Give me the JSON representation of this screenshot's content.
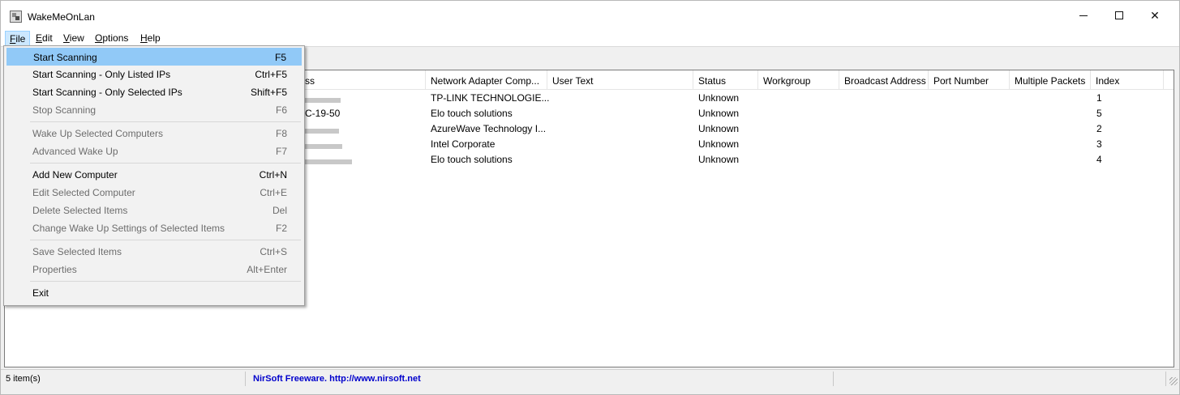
{
  "window": {
    "title": "WakeMeOnLan"
  },
  "menubar": {
    "items": [
      {
        "label": "File",
        "access_key": "F",
        "rest": "ile"
      },
      {
        "label": "Edit",
        "access_key": "E",
        "rest": "dit"
      },
      {
        "label": "View",
        "access_key": "V",
        "rest": "iew"
      },
      {
        "label": "Options",
        "access_key": "O",
        "rest": "ptions"
      },
      {
        "label": "Help",
        "access_key": "H",
        "rest": "elp"
      }
    ]
  },
  "file_menu": {
    "items": [
      {
        "label": "Start Scanning",
        "shortcut": "F5",
        "enabled": true,
        "highlighted": true
      },
      {
        "label": "Start Scanning - Only Listed IPs",
        "shortcut": "Ctrl+F5",
        "enabled": true
      },
      {
        "label": "Start Scanning - Only Selected IPs",
        "shortcut": "Shift+F5",
        "enabled": true
      },
      {
        "label": "Stop Scanning",
        "shortcut": "F6",
        "enabled": false
      },
      {
        "label": "Wake Up Selected Computers",
        "shortcut": "F8",
        "enabled": false
      },
      {
        "label": "Advanced Wake Up",
        "shortcut": "F7",
        "enabled": false
      },
      {
        "label": "Add New Computer",
        "shortcut": "Ctrl+N",
        "enabled": true
      },
      {
        "label": "Edit Selected Computer",
        "shortcut": "Ctrl+E",
        "enabled": false
      },
      {
        "label": "Delete Selected Items",
        "shortcut": "Del",
        "enabled": false
      },
      {
        "label": "Change Wake Up Settings of Selected Items",
        "shortcut": "F2",
        "enabled": false
      },
      {
        "label": "Save Selected Items",
        "shortcut": "Ctrl+S",
        "enabled": false
      },
      {
        "label": "Properties",
        "shortcut": "Alt+Enter",
        "enabled": false
      },
      {
        "label": "Exit",
        "shortcut": "",
        "enabled": true
      }
    ]
  },
  "table": {
    "columns": [
      "ss",
      "Network Adapter Comp...",
      "User Text",
      "Status",
      "Workgroup",
      "Broadcast Address",
      "Port Number",
      "Multiple Packets",
      "Index"
    ],
    "rows": [
      {
        "mac": "",
        "adapter": "TP-LINK TECHNOLOGIE...",
        "user_text": "",
        "status": "Unknown",
        "index": "1"
      },
      {
        "mac": "C-19-50",
        "adapter": "Elo touch solutions",
        "user_text": "",
        "status": "Unknown",
        "index": "5"
      },
      {
        "mac": "",
        "adapter": "AzureWave Technology I...",
        "user_text": "",
        "status": "Unknown",
        "index": "2"
      },
      {
        "mac": "",
        "adapter": "Intel Corporate",
        "user_text": "",
        "status": "Unknown",
        "index": "3"
      },
      {
        "mac": "",
        "adapter": "Elo touch solutions",
        "user_text": "",
        "status": "Unknown",
        "index": "4"
      }
    ]
  },
  "statusbar": {
    "count": "5 item(s)",
    "credit": "NirSoft Freeware.  http://www.nirsoft.net"
  },
  "colors": {
    "menu_highlight": "#91c9f7",
    "menubar_active": "#cce8ff",
    "disabled_text": "#6d6d6d",
    "link": "#0000cc"
  }
}
